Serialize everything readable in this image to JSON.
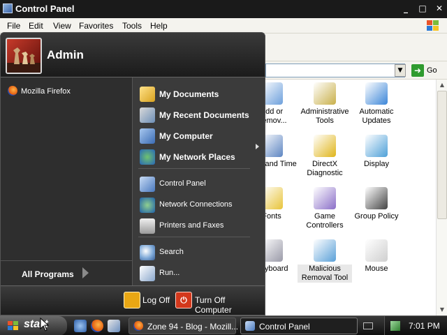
{
  "window": {
    "title": "Control Panel",
    "controls": {
      "minimize": "_",
      "maximize": "□",
      "close": "✕"
    },
    "menu": [
      "File",
      "Edit",
      "View",
      "Favorites",
      "Tools",
      "Help"
    ],
    "address": {
      "value": "",
      "go_label": "Go",
      "dropdown_glyph": "▼"
    },
    "items": [
      {
        "label": "Add or Remov...",
        "icon": "add-remove-programs-icon"
      },
      {
        "label": "Administrative Tools",
        "icon": "administrative-tools-icon"
      },
      {
        "label": "Automatic Updates",
        "icon": "automatic-updates-icon"
      },
      {
        "label": "Date and Time",
        "icon": "date-time-icon"
      },
      {
        "label": "DirectX Diagnostic",
        "icon": "directx-icon"
      },
      {
        "label": "Display",
        "icon": "display-icon"
      },
      {
        "label": "Fonts",
        "icon": "fonts-folder-icon"
      },
      {
        "label": "Game Controllers",
        "icon": "game-controller-icon"
      },
      {
        "label": "Group Policy",
        "icon": "group-policy-icon"
      },
      {
        "label": "Keyboard",
        "icon": "keyboard-icon"
      },
      {
        "label": "Malicious Removal Tool",
        "icon": "malicious-removal-tool-icon"
      },
      {
        "label": "Mouse",
        "icon": "mouse-icon"
      }
    ],
    "item_label_lines": [
      [
        "Add or",
        "Remov..."
      ],
      [
        "Administrative",
        "Tools"
      ],
      [
        "Automatic",
        "Updates"
      ],
      [
        "Date and Time"
      ],
      [
        "DirectX",
        "Diagnostic"
      ],
      [
        "Display"
      ],
      [
        "Fonts"
      ],
      [
        "Game",
        "Controllers"
      ],
      [
        "Group Policy"
      ],
      [
        "Keyboard"
      ],
      [
        "Malicious",
        "Removal Tool"
      ],
      [
        "Mouse"
      ]
    ]
  },
  "start_menu": {
    "username": "Admin",
    "pinned": [
      "Mozilla Firefox"
    ],
    "all_programs": "All Programs",
    "places": [
      {
        "label": "My Documents",
        "icon": "my-documents-icon"
      },
      {
        "label": "My Recent Documents",
        "icon": "recent-documents-icon",
        "submenu": true
      },
      {
        "label": "My Computer",
        "icon": "my-computer-icon"
      },
      {
        "label": "My Network Places",
        "icon": "network-places-icon"
      }
    ],
    "system": [
      {
        "label": "Control Panel",
        "icon": "control-panel-icon"
      },
      {
        "label": "Network Connections",
        "icon": "network-connections-icon"
      },
      {
        "label": "Printers and Faxes",
        "icon": "printer-icon"
      }
    ],
    "tools": [
      {
        "label": "Search",
        "icon": "search-icon"
      },
      {
        "label": "Run...",
        "icon": "run-icon"
      }
    ],
    "log_off": "Log Off",
    "turn_off": "Turn Off Computer"
  },
  "taskbar": {
    "start_label": "start",
    "tasks": [
      {
        "label": "Zone 94 - Blog - Mozill...",
        "active": false
      },
      {
        "label": "Control Panel",
        "active": true
      }
    ],
    "clock": "7:01 PM"
  },
  "colors": {
    "start_menu_bg": "#2b2b2b",
    "taskbar_bg": "#1a1a1a",
    "go_green": "#2f9b2f",
    "turn_off_red": "#d3381c",
    "log_off_gold": "#e9a714"
  }
}
